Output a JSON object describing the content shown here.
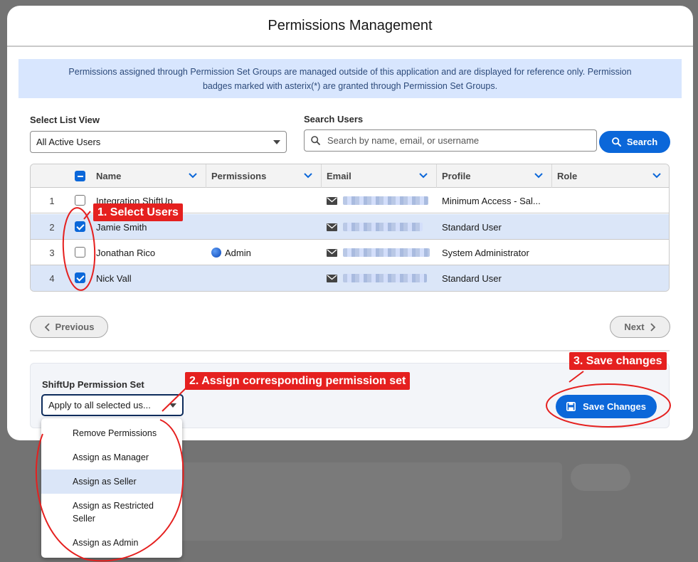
{
  "modal": {
    "title": "Permissions Management"
  },
  "info_banner": {
    "line1": "Permissions assigned through Permission Set Groups are managed outside of this application and are displayed for reference only. Permission",
    "line2": "badges marked with asterix(*) are granted through Permission Set Groups."
  },
  "list_view": {
    "label": "Select List View",
    "value": "All Active Users"
  },
  "search": {
    "label": "Search Users",
    "placeholder": "Search by name, email, or username",
    "button": "Search"
  },
  "table": {
    "columns": [
      "Name",
      "Permissions",
      "Email",
      "Profile",
      "Role"
    ],
    "rows": [
      {
        "num": "1",
        "name": "Integration ShiftUp",
        "permission": "",
        "profile": "Minimum Access - Sal...",
        "selected": false
      },
      {
        "num": "2",
        "name": "Jamie Smith",
        "permission": "",
        "profile": "Standard User",
        "selected": true
      },
      {
        "num": "3",
        "name": "Jonathan Rico",
        "permission": "Admin",
        "profile": "System Administrator",
        "selected": false
      },
      {
        "num": "4",
        "name": "Nick Vall",
        "permission": "",
        "profile": "Standard User",
        "selected": true
      }
    ]
  },
  "pagination": {
    "previous": "Previous",
    "next": "Next"
  },
  "permission_set": {
    "label": "ShiftUp Permission Set",
    "value": "Apply to all selected us...",
    "options": [
      "Remove Permissions",
      "Assign as Manager",
      "Assign as Seller",
      "Assign as Restricted Seller",
      "Assign as Admin"
    ],
    "highlighted": "Assign as Seller"
  },
  "save_button": "Save Changes",
  "annotations": {
    "step1": "1. Select Users",
    "step2": "2. Assign corresponding permission set",
    "step3": "3. Save changes"
  },
  "colors": {
    "brand": "#0b67d9",
    "annotation": "#e5201f",
    "selected_row": "#dbe6f8",
    "banner": "#d8e6fe"
  }
}
